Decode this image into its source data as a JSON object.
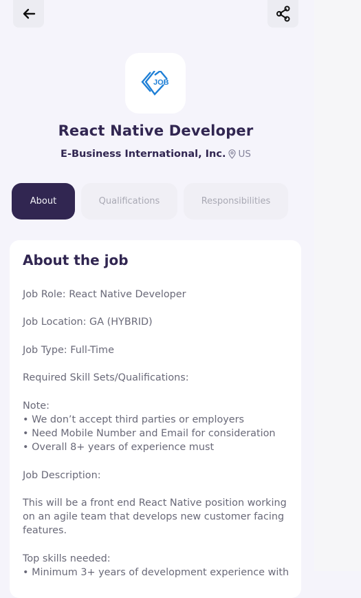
{
  "header": {
    "back_icon": "arrow-left-icon",
    "share_icon": "share-icon"
  },
  "company": {
    "logo_text": "JOB",
    "logo_icon": "company-logo-icon",
    "name": "E-Business International, Inc.",
    "location": "US",
    "location_icon": "location-pin-icon"
  },
  "job": {
    "title": "React Native Developer"
  },
  "tabs": [
    {
      "label": "About",
      "active": true
    },
    {
      "label": "Qualifications",
      "active": false
    },
    {
      "label": "Responsibilities",
      "active": false
    }
  ],
  "about": {
    "heading": "About the job",
    "body": "Job Role: React Native Developer\n\nJob Location: GA (HYBRID)\n\nJob Type: Full-Time\n\nRequired Skill Sets/Qualifications:\n\nNote:\n• We don’t accept third parties or employers\n• Need Mobile Number and Email for consideration\n• Overall 8+ years of experience must\n\nJob Description:\n\nThis will be a front end React Native position working on an agile team that develops new customer facing features.\n\nTop skills needed:\n• Minimum 3+ years of development experience with"
  },
  "colors": {
    "primary": "#312651",
    "background": "#F5F4FB",
    "muted_text": "#83829A",
    "logo_blue": "#1E7FD6"
  }
}
